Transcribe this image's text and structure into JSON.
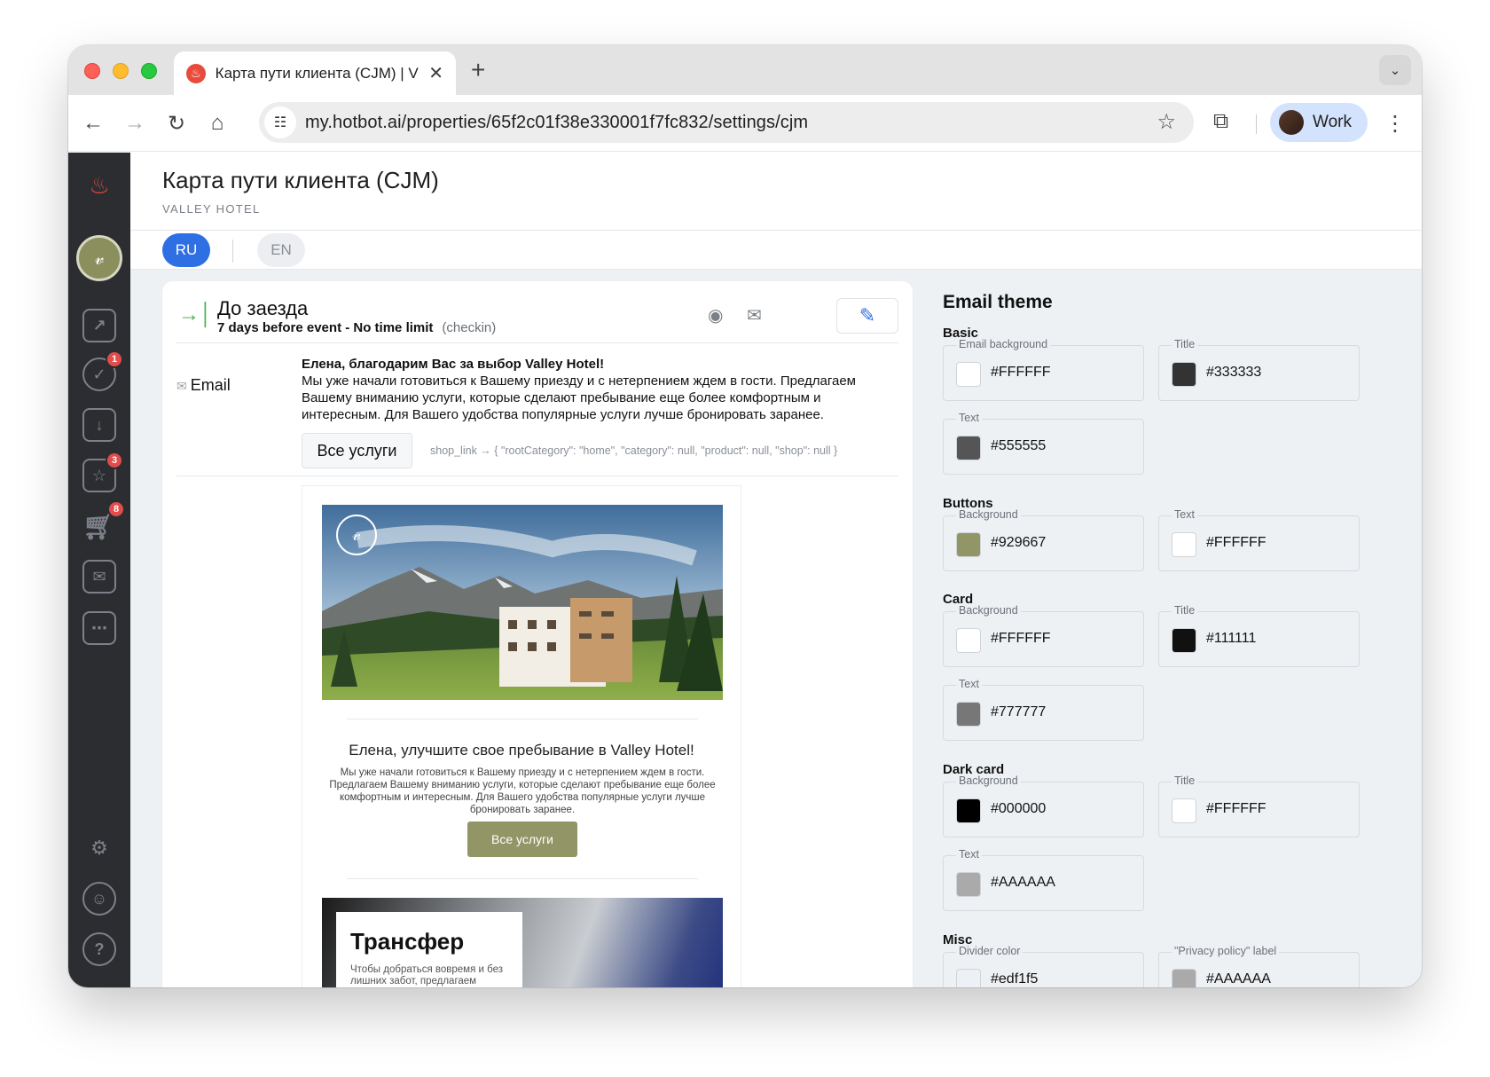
{
  "browser": {
    "tab_title": "Карта пути клиента (CJM) | V",
    "url": "my.hotbot.ai/properties/65f2c01f38e330001f7fc832/settings/cjm",
    "profile_label": "Work"
  },
  "sidebar": {
    "badges": {
      "tasks": "1",
      "reviews": "3",
      "cart": "8"
    }
  },
  "page": {
    "title": "Карта пути клиента (CJM)",
    "subtitle": "VALLEY HOTEL"
  },
  "languages": {
    "active": "RU",
    "other": "EN"
  },
  "step": {
    "title": "До заезда",
    "meta": "7 days before event - No time limit",
    "code": "(checkin)",
    "channel_label": "Email",
    "message_title": "Елена, благодарим Вас за выбор Valley Hotel!",
    "message_body": "Мы уже начали готовиться к Вашему приезду и с нетерпением ждем в гости. Предлагаем Вашему вниманию услуги, которые сделают пребывание еще более комфортным и интересным. Для Вашего удобства популярные услуги лучше бронировать заранее.",
    "button_label": "Все услуги",
    "shop_link": "shop_link → { \"rootCategory\": \"home\", \"category\": null, \"product\": null, \"shop\": null }"
  },
  "preview": {
    "title": "Елена, улучшите свое пребывание в Valley Hotel!",
    "text": "Мы уже начали готовиться к Вашему приезду и с нетерпением ждем в гости. Предлагаем Вашему вниманию услуги, которые сделают пребывание еще более комфортным и интересным. Для Вашего удобства популярные услуги лучше бронировать заранее.",
    "button_label": "Все услуги",
    "transfer_title": "Трансфер",
    "transfer_text": "Чтобы добраться вовремя и без лишних забот, предлагаем воспользоваться"
  },
  "theme": {
    "title": "Email theme",
    "sections": {
      "basic": "Basic",
      "buttons": "Buttons",
      "card": "Card",
      "dark_card": "Dark card",
      "misc": "Misc"
    },
    "fields": {
      "basic_bg": {
        "label": "Email background",
        "value": "#FFFFFF",
        "color": "#FFFFFF"
      },
      "basic_title": {
        "label": "Title",
        "value": "#333333",
        "color": "#333333"
      },
      "basic_text": {
        "label": "Text",
        "value": "#555555",
        "color": "#555555"
      },
      "btn_bg": {
        "label": "Background",
        "value": "#929667",
        "color": "#929667"
      },
      "btn_text": {
        "label": "Text",
        "value": "#FFFFFF",
        "color": "#FFFFFF"
      },
      "card_bg": {
        "label": "Background",
        "value": "#FFFFFF",
        "color": "#FFFFFF"
      },
      "card_title": {
        "label": "Title",
        "value": "#111111",
        "color": "#111111"
      },
      "card_text": {
        "label": "Text",
        "value": "#777777",
        "color": "#777777"
      },
      "dark_bg": {
        "label": "Background",
        "value": "#000000",
        "color": "#000000"
      },
      "dark_title": {
        "label": "Title",
        "value": "#FFFFFF",
        "color": "#FFFFFF"
      },
      "dark_text": {
        "label": "Text",
        "value": "#AAAAAA",
        "color": "#AAAAAA"
      },
      "misc_divider": {
        "label": "Divider color",
        "value": "#edf1f5",
        "color": "#edf1f5"
      },
      "misc_privacy": {
        "label": "\"Privacy policy\" label",
        "value": "#AAAAAA",
        "color": "#AAAAAA"
      }
    }
  },
  "colors": {
    "accent": "#2f6fe4",
    "brand_olive": "#929667",
    "rail": "#2b2d31",
    "badge": "#e24c4b"
  }
}
